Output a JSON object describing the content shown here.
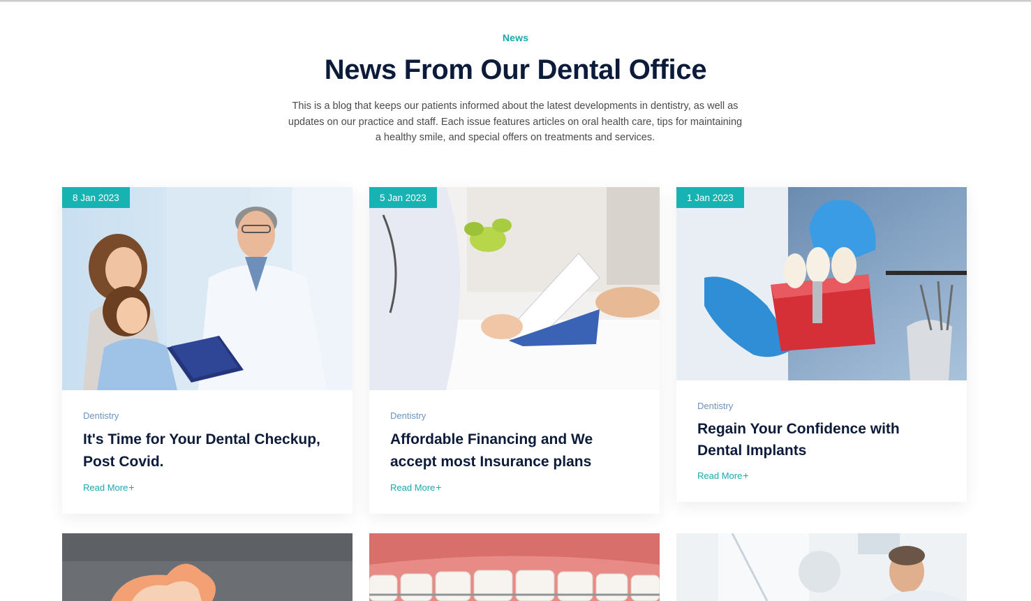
{
  "section": {
    "eyebrow": "News",
    "title": "News From Our Dental Office",
    "intro": "This is a blog that keeps our patients informed about the latest developments in dentistry, as well as updates on our practice and staff. Each issue features articles on oral health care, tips for maintaining a healthy smile, and special offers on treatments and services."
  },
  "posts": [
    {
      "date": "8 Jan 2023",
      "category": "Dentistry",
      "title": "It's Time for Your Dental Checkup, Post Covid.",
      "read_more": "Read More",
      "read_more_icon": "+"
    },
    {
      "date": "5 Jan 2023",
      "category": "Dentistry",
      "title": "Affordable Financing and We accept most Insurance plans",
      "read_more": "Read More",
      "read_more_icon": "+"
    },
    {
      "date": "1 Jan 2023",
      "category": "Dentistry",
      "title": "Regain Your Confidence with Dental Implants",
      "read_more": "Read More",
      "read_more_icon": "+"
    }
  ],
  "colors": {
    "accent": "#17b3b3",
    "heading": "#0c1b3a",
    "category": "#6d93bf",
    "body_text": "#4a4a4a"
  }
}
